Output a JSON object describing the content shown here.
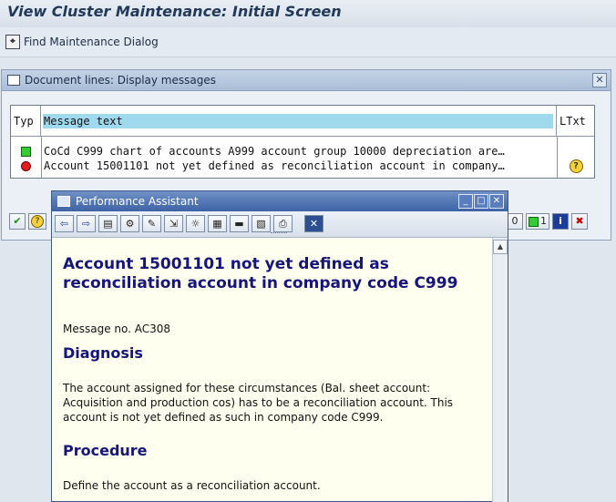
{
  "window": {
    "title": "View Cluster Maintenance: Initial Screen"
  },
  "app_toolbar": {
    "find_label": "Find Maintenance Dialog"
  },
  "messages_dialog": {
    "title": "Document lines: Display messages",
    "close_glyph": "✕",
    "columns": [
      "Typ",
      "Message text",
      "LTxt"
    ],
    "rows": [
      {
        "type": "green-led",
        "text": "CoCd C999 chart of accounts A999 account group 10000 depreciation are…",
        "ltxt": ""
      },
      {
        "type": "red-led",
        "text": "Account 15001101 not yet defined as reconciliation account in company…",
        "ltxt": "help-icon"
      }
    ],
    "toolbar_left": [
      "check-icon",
      "help-icon"
    ],
    "toolbar_right": {
      "count_left": "0",
      "count_green": "1"
    }
  },
  "performance_assistant": {
    "title": "Performance Assistant",
    "window_buttons": [
      "_",
      "□",
      "✕"
    ],
    "heading": "Account 15001101 not yet defined as reconciliation account in company code C999",
    "message_no": "Message no. AC308",
    "diagnosis_title": "Diagnosis",
    "diagnosis_text": "The account assigned for these circumstances (Bal. sheet account: Acquisition and production cos) has to be a reconciliation account. This account is not yet defined as such in company code C999.",
    "procedure_title": "Procedure",
    "procedure_text": "Define the account as a reconciliation account.",
    "toolbar_icons": [
      "back-icon",
      "forward-icon",
      "book-icon",
      "technical-info-icon",
      "edit-icon",
      "scroll-icon",
      "settings-icon",
      "table-icon",
      "fields-icon",
      "print-preview-icon",
      "print-icon",
      "close-icon"
    ],
    "colors": {
      "heading": "#15157a",
      "content_bg": "#fffff0",
      "title_bar": "#3e63a6"
    }
  }
}
